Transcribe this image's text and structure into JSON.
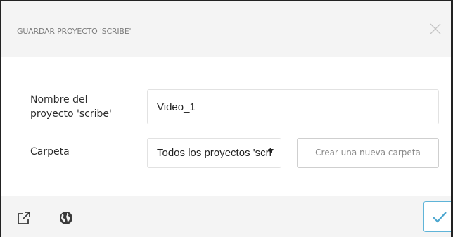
{
  "dialog": {
    "title": "GUARDAR PROYECTO 'SCRIBE'",
    "close_icon": "close-icon"
  },
  "form": {
    "name_label": "Nombre del proyecto 'scribe'",
    "name_value": "Video_1",
    "folder_label": "Carpeta",
    "folder_selected": "Todos los proyectos 'scribe'",
    "new_folder_label": "Crear una nueva carpeta"
  },
  "footer": {
    "icons": [
      "external-link-icon",
      "globe-icon"
    ],
    "confirm_icon": "checkmark-icon"
  },
  "colors": {
    "panel_background": "#f4f4f4",
    "accent": "#5fb4d8",
    "muted_text": "#7c7c7c"
  }
}
